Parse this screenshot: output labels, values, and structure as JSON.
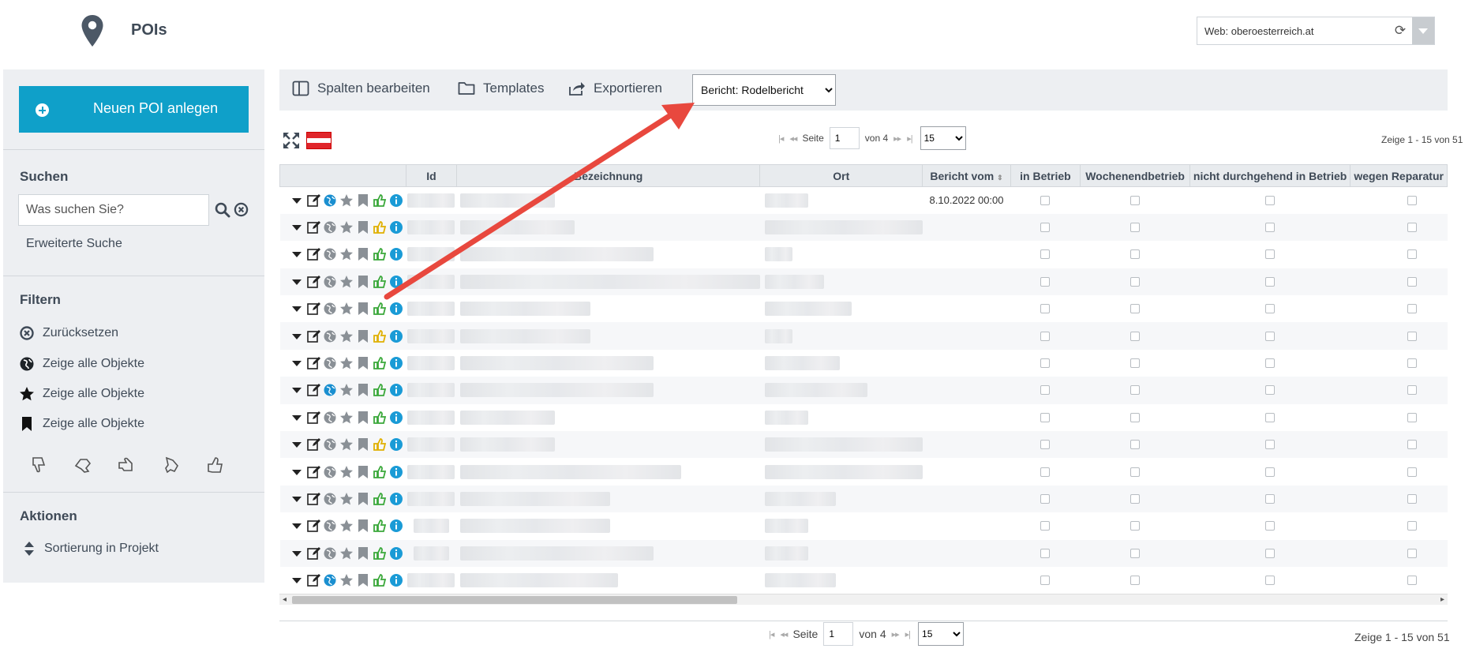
{
  "header": {
    "title": "POIs",
    "web_selector": "Web: oberoesterreich.at"
  },
  "sidebar": {
    "new_button": "Neuen POI anlegen",
    "search_heading": "Suchen",
    "search_placeholder": "Was suchen Sie?",
    "advanced_search": "Erweiterte Suche",
    "filter_heading": "Filtern",
    "filters": [
      "Zurücksetzen",
      "Zeige alle Objekte",
      "Zeige alle Objekte",
      "Zeige alle Objekte"
    ],
    "actions_heading": "Aktionen",
    "actions": [
      "Sortierung in Projekt"
    ]
  },
  "toolbar": {
    "edit_columns": "Spalten bearbeiten",
    "templates": "Templates",
    "export": "Exportieren",
    "report_selected": "Bericht: Rodelbericht"
  },
  "pager": {
    "page_label": "Seite",
    "page": "1",
    "of": "von 4",
    "page_size": "15",
    "records": "Zeige 1 - 15 von 51"
  },
  "table": {
    "columns": [
      "",
      "Id",
      "Bezeichnung",
      "Ort",
      "Bericht vom",
      "in Betrieb",
      "Wochenendbetrieb",
      "nicht durchgehend in Betrieb",
      "wegen Reparatur"
    ],
    "first_row_date": "8.10.2022 00:00",
    "row_count": 15
  },
  "colors": {
    "accent": "#0fa0c9",
    "arrow": "#e8483e",
    "sidebar_bg": "#edeff2",
    "thumb_green": "#3aa83a",
    "thumb_yellow": "#e0b000",
    "info_blue": "#1a9bd6"
  },
  "icons": {
    "header": "map-pin-icon",
    "row_actions": [
      "caret-down-icon",
      "edit-icon",
      "globe-icon",
      "star-icon",
      "bookmark-icon",
      "thumb-icon",
      "info-icon"
    ]
  }
}
